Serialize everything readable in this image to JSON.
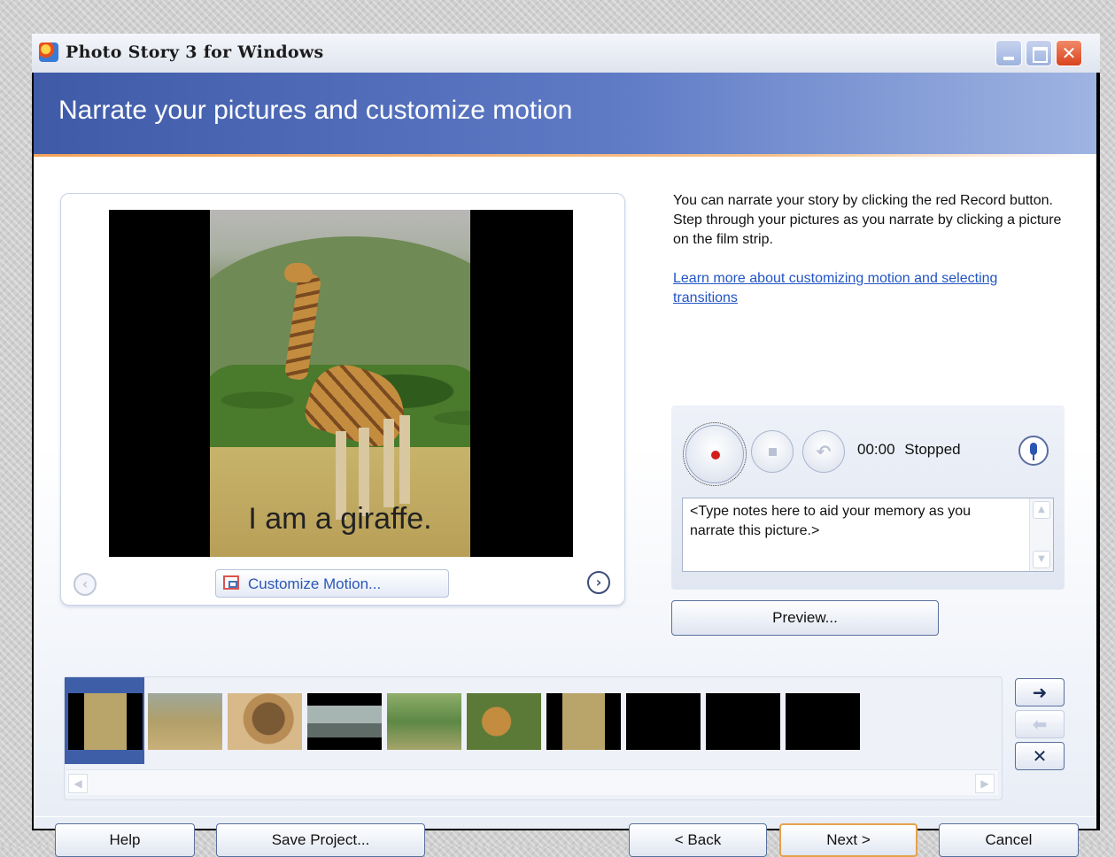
{
  "window": {
    "title": "Photo Story 3 for Windows"
  },
  "banner": {
    "heading": "Narrate your pictures and customize motion"
  },
  "preview": {
    "caption": "I am a giraffe.",
    "customize_label": "Customize Motion..."
  },
  "instructions": {
    "text": "You can narrate your story by clicking the red Record button. Step through your pictures as you narrate by clicking a picture on the film strip.",
    "link": "Learn more about customizing motion and selecting transitions"
  },
  "recorder": {
    "time": "00:00",
    "status": "Stopped",
    "notes_placeholder": "<Type notes here to aid your memory as you narrate this picture.>"
  },
  "preview_button": "Preview...",
  "filmstrip": {
    "selected_index": 0,
    "count": 10
  },
  "footer": {
    "help": "Help",
    "save": "Save Project...",
    "back": "< Back",
    "next": "Next >",
    "cancel": "Cancel"
  },
  "icons": {
    "record": "record-icon",
    "stop": "stop-icon",
    "undo": "undo-icon",
    "microphone": "microphone-icon",
    "move_right": "arrow-right-icon",
    "move_left": "arrow-left-icon",
    "remove": "close-icon"
  },
  "colors": {
    "banner": "#3f5ba8",
    "accent_line": "#f4a259",
    "link": "#2255c4",
    "record": "#d0201b",
    "selection": "#3e5fa8"
  }
}
